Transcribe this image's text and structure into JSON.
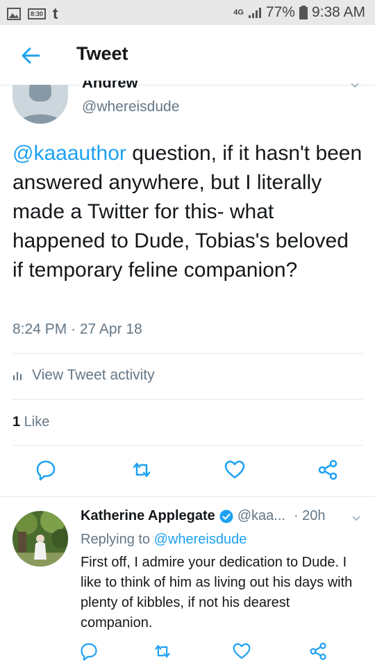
{
  "status_bar": {
    "left_time_badge": "8:30",
    "tumblr_glyph": "t",
    "network": "4G",
    "battery": "77%",
    "clock": "9:38 AM"
  },
  "app_bar": {
    "title": "Tweet"
  },
  "tweet": {
    "author_name": "Andrew",
    "author_handle": "@whereisdude",
    "text_mention": "@kaaauthor",
    "text_body": " question, if it hasn't been answered anywhere, but I literally made a Twitter for this- what happened to Dude, Tobias's beloved if temporary feline companion?",
    "timestamp": "8:24 PM · 27 Apr 18",
    "activity_label": "View Tweet activity",
    "like_count": "1",
    "like_label": " Like"
  },
  "reply": {
    "author_name": "Katherine Applegate",
    "author_handle": "@kaa...",
    "time": "· 20h",
    "replying_prefix": "Replying to ",
    "replying_handle": "@whereisdude",
    "text": "First off, I admire your dedication to Dude. I like to think of him as living out his days with plenty of kibbles, if not his dearest companion."
  },
  "colors": {
    "accent": "#1da1f2",
    "muted": "#657786",
    "text": "#14171a",
    "divider": "#e1e8ed"
  },
  "icons": [
    "back-arrow-icon",
    "reply-icon",
    "retweet-icon",
    "like-icon",
    "share-icon",
    "verified-icon",
    "chevron-down-icon",
    "bar-chart-icon"
  ]
}
